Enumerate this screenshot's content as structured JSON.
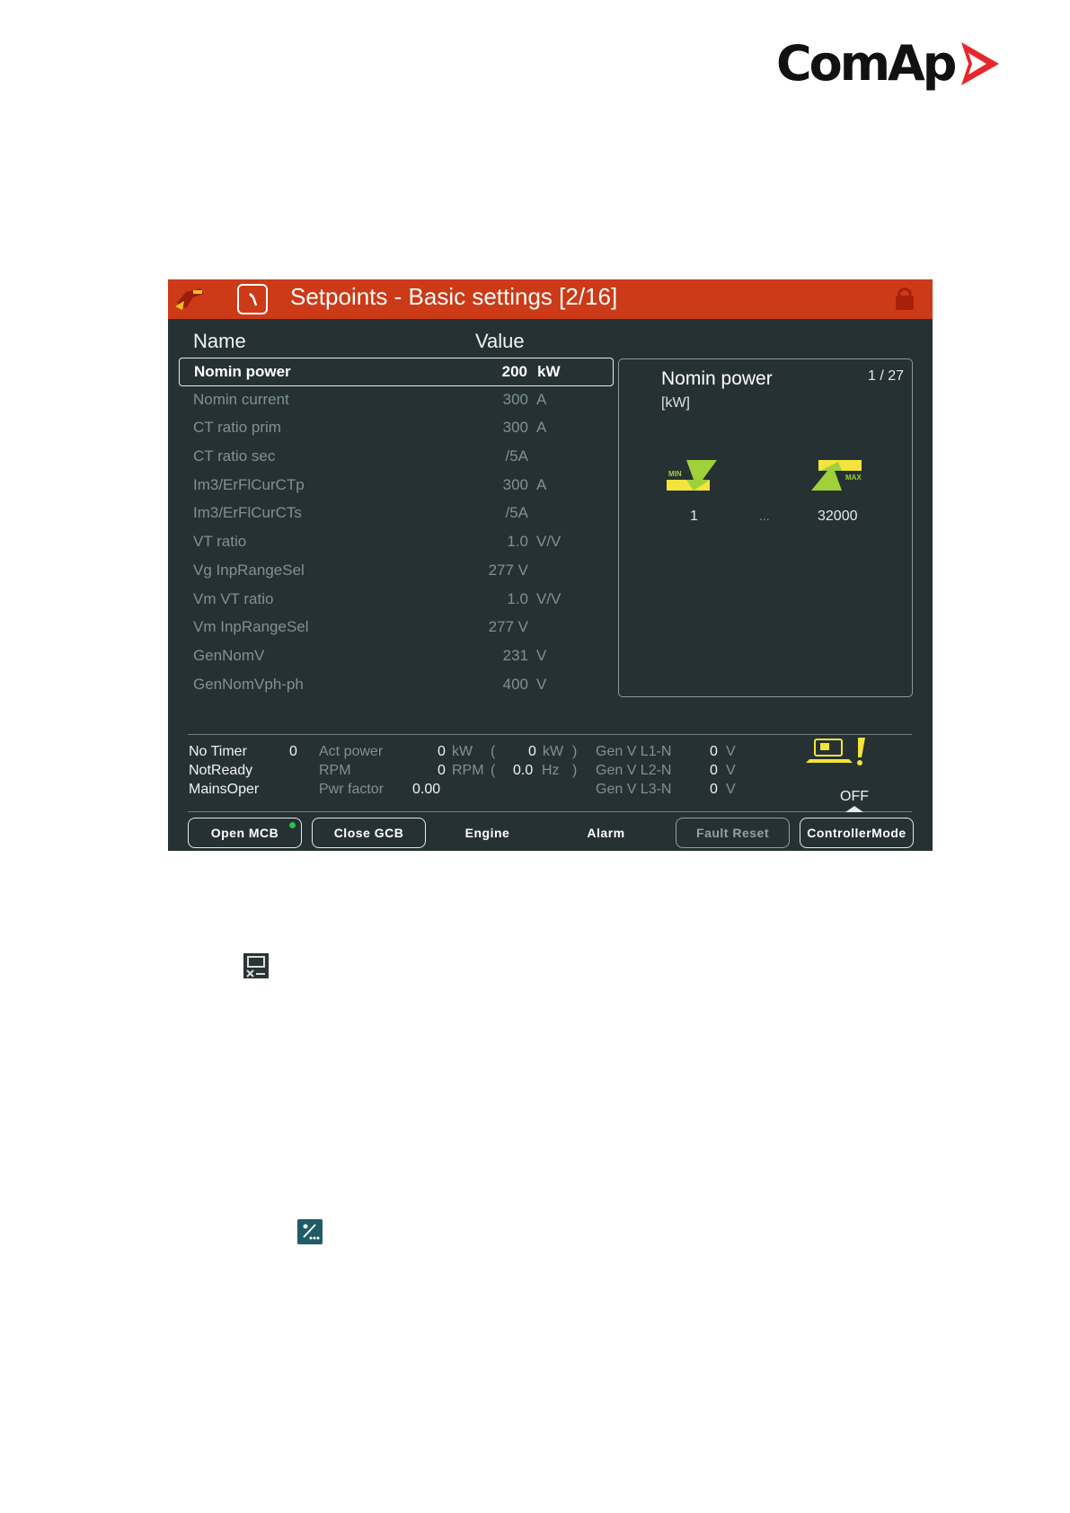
{
  "logo": {
    "text": "ComAp"
  },
  "screen": {
    "title": "Setpoints - Basic settings [2/16]",
    "columns": {
      "name": "Name",
      "value": "Value"
    },
    "setpoints": [
      {
        "name": "Nomin power",
        "value": "200",
        "unit": "kW"
      },
      {
        "name": "Nomin current",
        "value": "300",
        "unit": "A"
      },
      {
        "name": "CT ratio prim",
        "value": "300",
        "unit": "A"
      },
      {
        "name": "CT ratio sec",
        "value": "/5A",
        "unit": ""
      },
      {
        "name": "Im3/ErFlCurCTp",
        "value": "300",
        "unit": "A"
      },
      {
        "name": "Im3/ErFlCurCTs",
        "value": "/5A",
        "unit": ""
      },
      {
        "name": "VT ratio",
        "value": "1.0",
        "unit": "V/V"
      },
      {
        "name": "Vg InpRangeSel",
        "value": "277 V",
        "unit": ""
      },
      {
        "name": "Vm VT ratio",
        "value": "1.0",
        "unit": "V/V"
      },
      {
        "name": "Vm InpRangeSel",
        "value": "277 V",
        "unit": ""
      },
      {
        "name": "GenNomV",
        "value": "231",
        "unit": "V"
      },
      {
        "name": "GenNomVph-ph",
        "value": "400",
        "unit": "V"
      }
    ],
    "detail": {
      "title": "Nomin power",
      "page": "1 / 27",
      "unit": "[kW]",
      "min_label": "MIN",
      "max_label": "MAX",
      "min_value": "1",
      "dots": "...",
      "max_value": "32000"
    },
    "status": {
      "timer_label": "No Timer",
      "timer_value": "0",
      "state1": "NotReady",
      "state2": "MainsOper",
      "act_power_label": "Act power",
      "act_power_value": "0",
      "act_power_unit": "kW",
      "paren_open1": "(",
      "act_power_value2": "0",
      "act_power_unit2": "kW",
      "paren_close1": ")",
      "rpm_label": "RPM",
      "rpm_value": "0",
      "rpm_unit": "RPM",
      "paren_open2": "(",
      "hz_value": "0.0",
      "hz_unit": "Hz",
      "paren_close2": ")",
      "pf_label": "Pwr factor",
      "pf_value": "0.00",
      "genv1_label": "Gen V L1-N",
      "genv1_value": "0",
      "genv2_label": "Gen V L2-N",
      "genv2_value": "0",
      "genv3_label": "Gen V L3-N",
      "genv3_value": "0",
      "volt_unit": "V",
      "mode": "OFF"
    },
    "buttons": {
      "open_mcb": "Open MCB",
      "close_gcb": "Close GCB",
      "engine": "Engine",
      "alarm": "Alarm",
      "fault_reset": "Fault Reset",
      "controller_mode": "ControllerMode"
    }
  },
  "colors": {
    "title_bar": "#cc3a18",
    "screen_bg": "#263133",
    "logo_red": "#e8262b",
    "min_max_icon": "#9fd13a",
    "warning": "#f3e33a"
  }
}
